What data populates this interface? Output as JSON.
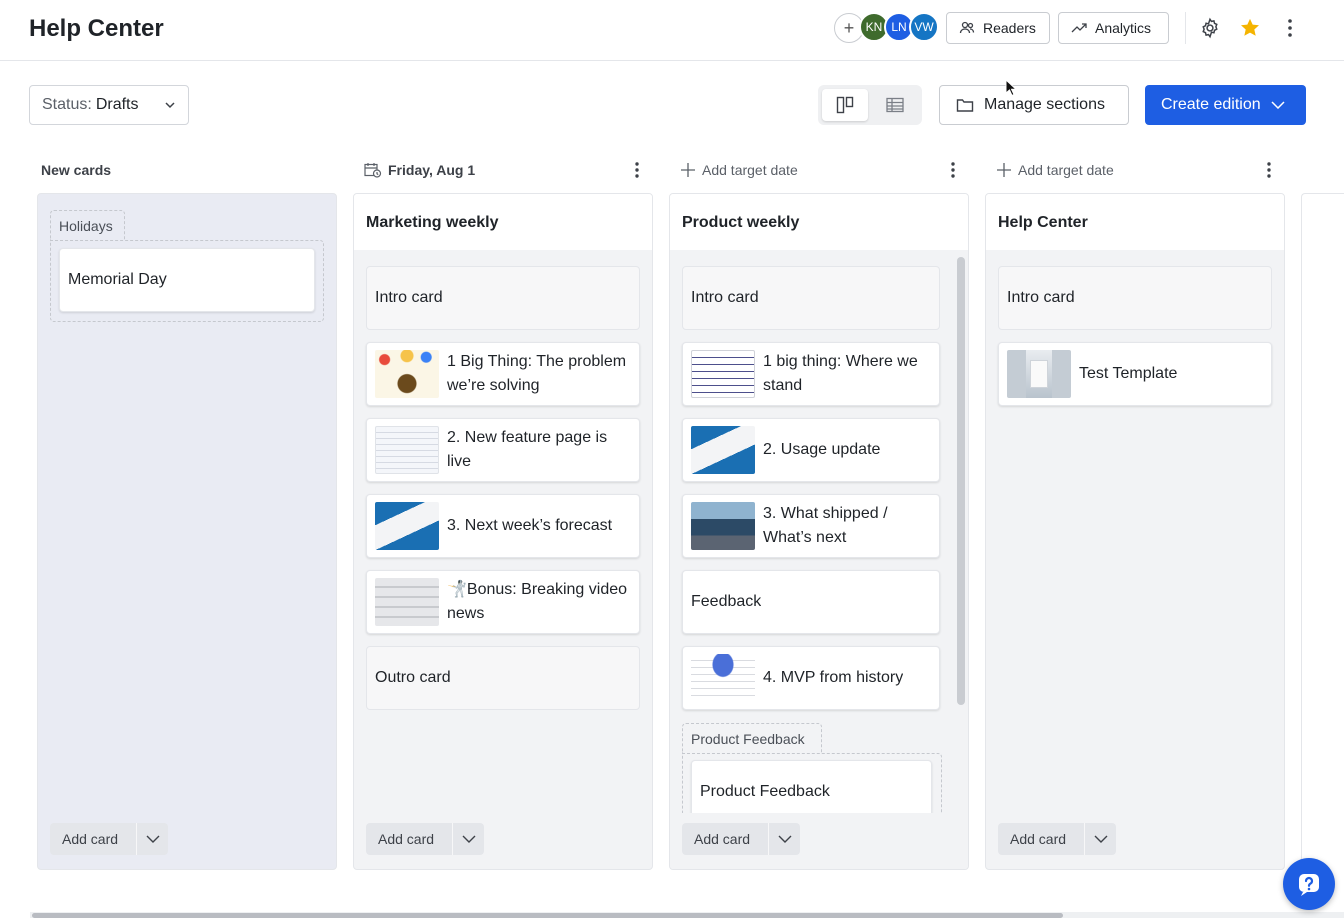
{
  "header": {
    "title": "Help Center",
    "avatars": [
      "KN",
      "LN",
      "VW"
    ],
    "readers_label": "Readers",
    "analytics_label": "Analytics"
  },
  "toolbar": {
    "status_label": "Status:",
    "status_value": "Drafts",
    "manage_sections_label": "Manage sections",
    "create_edition_label": "Create edition"
  },
  "columns": [
    {
      "header": "New cards",
      "section": "Holidays",
      "cards": [
        {
          "label": "Memorial Day"
        }
      ],
      "add_card": "Add card"
    },
    {
      "header": "Friday, Aug 1",
      "title": "Marketing weekly",
      "cards": [
        {
          "label": "Intro card"
        },
        {
          "label": "1 Big Thing: The problem we’re solving"
        },
        {
          "label": "2. New feature page is live"
        },
        {
          "label": "3. Next week’s forecast"
        },
        {
          "label": "🤺Bonus: Breaking video news"
        },
        {
          "label": "Outro card"
        }
      ],
      "add_card": "Add card"
    },
    {
      "header": "Add target date",
      "title": "Product weekly",
      "cards": [
        {
          "label": "Intro card"
        },
        {
          "label": "1 big thing: Where we stand"
        },
        {
          "label": "2. Usage update"
        },
        {
          "label": "3. What shipped / What’s next"
        },
        {
          "label": "Feedback"
        },
        {
          "label": "4. MVP from history"
        }
      ],
      "section": "Product Feedback",
      "section_cards": [
        {
          "label": "Product Feedback"
        }
      ],
      "add_card": "Add card"
    },
    {
      "header": "Add target date",
      "title": "Help Center",
      "cards": [
        {
          "label": "Intro card"
        },
        {
          "label": "Test Template"
        }
      ],
      "add_card": "Add card"
    }
  ],
  "icons": {
    "add_avatar": "plus-icon",
    "readers": "people-icon",
    "analytics": "trend-icon",
    "settings": "gear-icon",
    "favorite": "star-icon",
    "more": "kebab-icon",
    "help": "help-icon"
  },
  "colors": {
    "accent": "#1e5ee3",
    "star": "#f5b400",
    "column_bg": "#f2f3f5",
    "new_column_bg": "#e9ebf3"
  }
}
